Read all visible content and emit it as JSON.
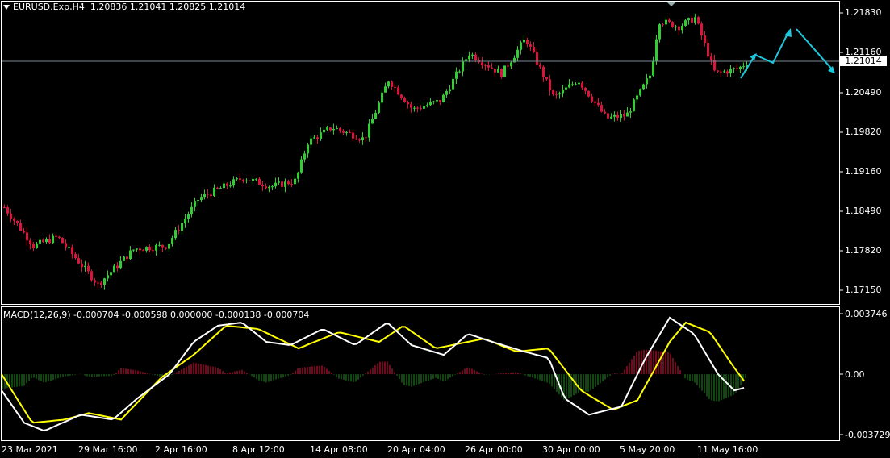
{
  "chart_data": [
    {
      "type": "candlestick",
      "symbol_line": "EURUSD.Exp,H4  1.20836 1.21041 1.20825 1.21014",
      "y_ticks": [
        "1.21830",
        "1.21160",
        "1.20490",
        "1.19820",
        "1.19160",
        "1.18490",
        "1.17820",
        "1.17150"
      ],
      "ylim": [
        1.167,
        1.223
      ],
      "current_price": 1.21014,
      "current_price_label": "1.21014",
      "colors": {
        "up": "#32cd32",
        "down": "#dc143c",
        "arrow": "#1ec8dc",
        "grid_line": "#778899"
      },
      "forecast_arrows": "cyan zig-zag continuation up then down at right edge"
    },
    {
      "type": "line",
      "title": "MACD(12,26,9) -0.000704 -0.000598 0.000000 -0.000138 -0.000704",
      "y_ticks": [
        "0.003746",
        "0.00",
        "-0.003729"
      ],
      "ylim": [
        -0.003729,
        0.003746
      ],
      "colors": {
        "macd": "#ffffff",
        "signal": "#ffff00",
        "hist_up": "#dc143c",
        "hist_down": "#228b22"
      }
    }
  ],
  "x_labels": [
    "23 Mar 2021",
    "29 Mar 16:00",
    "2 Apr 16:00",
    "8 Apr 12:00",
    "14 Apr 08:00",
    "20 Apr 04:00",
    "26 Apr 00:00",
    "30 Apr 00:00",
    "5 May 20:00",
    "11 May 16:00"
  ]
}
